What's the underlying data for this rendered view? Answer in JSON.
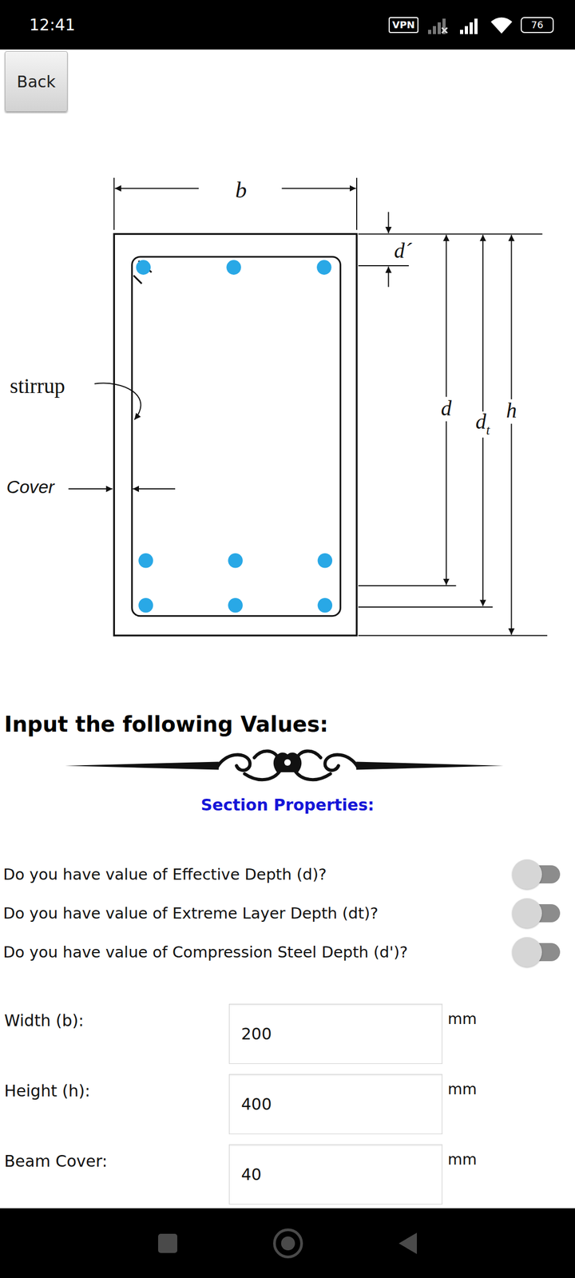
{
  "status_bar": {
    "time": "12:41",
    "vpn": "VPN",
    "battery": "76"
  },
  "back_button": {
    "label": "Back"
  },
  "diagram": {
    "width_label": "b",
    "cover_depth_label": "d´",
    "effective_depth_label": "d",
    "extreme_depth_label": "d",
    "extreme_depth_subscript": "t",
    "height_label": "h",
    "stirrup_label": "stirrup",
    "cover_label": "Cover",
    "rebar_rows": [
      3,
      3,
      3
    ]
  },
  "heading": "Input the following Values:",
  "section_title": "Section Properties:",
  "toggles": [
    {
      "label": "Do you have value of Effective Depth (d)?",
      "on": false
    },
    {
      "label": "Do you have value of Extreme Layer Depth (dt)?",
      "on": false
    },
    {
      "label": "Do you have value of Compression Steel Depth (d')?",
      "on": false
    }
  ],
  "fields": [
    {
      "label": "Width (b):",
      "value": "200",
      "unit": "mm"
    },
    {
      "label": "Height (h):",
      "value": "400",
      "unit": "mm"
    },
    {
      "label": "Beam Cover:",
      "value": "40",
      "unit": "mm"
    }
  ]
}
